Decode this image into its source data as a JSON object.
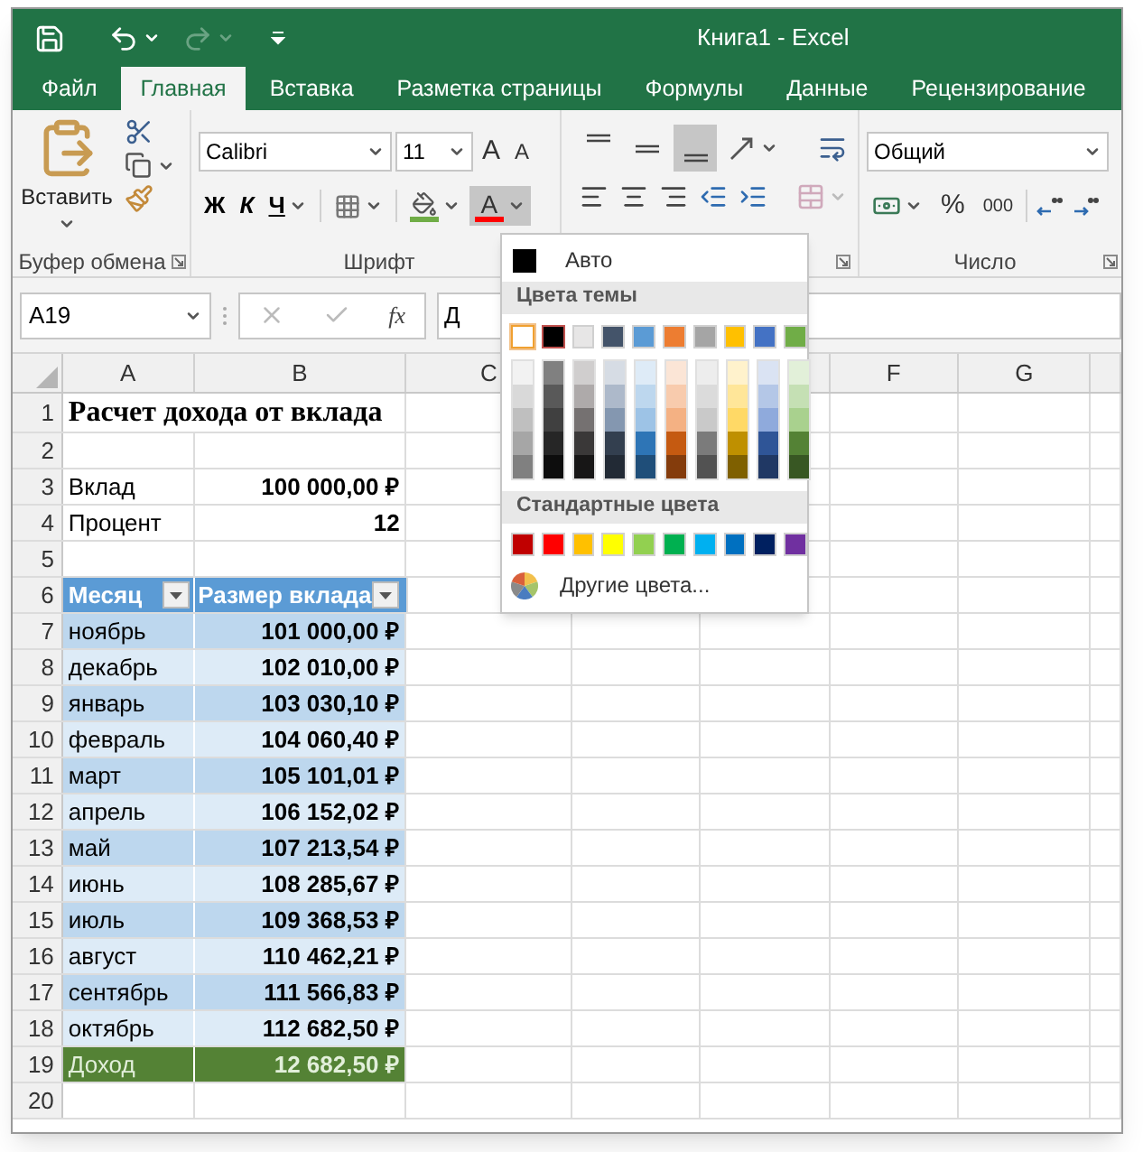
{
  "title_bar": {
    "title": "Книга1 - Excel",
    "redo_disabled": true
  },
  "tabs": [
    {
      "label": "Файл",
      "selected": false
    },
    {
      "label": "Главная",
      "selected": true
    },
    {
      "label": "Вставка",
      "selected": false
    },
    {
      "label": "Разметка страницы",
      "selected": false
    },
    {
      "label": "Формулы",
      "selected": false
    },
    {
      "label": "Данные",
      "selected": false
    },
    {
      "label": "Рецензирование",
      "selected": false
    }
  ],
  "ribbon": {
    "clipboard": {
      "paste_label": "Вставить",
      "group_label": "Буфер обмена"
    },
    "font": {
      "font_name": "Calibri",
      "font_size": "11",
      "grow_label": "A",
      "shrink_label": "A",
      "bold_label": "Ж",
      "italic_label": "К",
      "underline_label": "Ч",
      "font_color_label": "A",
      "font_color_bar": {
        "color": "#ff0000"
      },
      "fill_color_bar": {
        "color": "#70ad47"
      },
      "font_color_open": true,
      "group_label": "Шрифт"
    },
    "alignment": {
      "vertical": [
        {
          "kind": "top",
          "selected": false
        },
        {
          "kind": "middle",
          "selected": false
        },
        {
          "kind": "bottom",
          "selected": true
        }
      ],
      "merge_disabled": true
    },
    "number": {
      "format": "Общий",
      "percent_label": "%",
      "thousands_label": "000",
      "group_label": "Число"
    }
  },
  "formula_bar": {
    "name_box": "A19",
    "fx_label": "fx",
    "value": "Д"
  },
  "sheet": {
    "columns": [
      "A",
      "B",
      "C",
      null,
      null,
      "F",
      "G"
    ],
    "rows": [
      {
        "number": "1",
        "kind": "title",
        "cells": [
          "Расчет дохода от вклада"
        ]
      },
      {
        "number": "2",
        "kind": "empty"
      },
      {
        "number": "3",
        "kind": "plain",
        "cells": [
          "Вклад",
          "100 000,00 ₽"
        ]
      },
      {
        "number": "4",
        "kind": "plain",
        "cells": [
          "Процент",
          "12"
        ]
      },
      {
        "number": "5",
        "kind": "empty"
      },
      {
        "number": "6",
        "kind": "header",
        "cells": [
          "Месяц",
          "Размер вклада"
        ]
      },
      {
        "number": "7",
        "kind": "data",
        "cells": [
          "ноябрь",
          "101 000,00 ₽"
        ]
      },
      {
        "number": "8",
        "kind": "data",
        "cells": [
          "декабрь",
          "102 010,00 ₽"
        ]
      },
      {
        "number": "9",
        "kind": "data",
        "cells": [
          "январь",
          "103 030,10 ₽"
        ]
      },
      {
        "number": "10",
        "kind": "data",
        "cells": [
          "февраль",
          "104 060,40 ₽"
        ]
      },
      {
        "number": "11",
        "kind": "data",
        "cells": [
          "март",
          "105 101,01 ₽"
        ]
      },
      {
        "number": "12",
        "kind": "data",
        "cells": [
          "апрель",
          "106 152,02 ₽"
        ]
      },
      {
        "number": "13",
        "kind": "data",
        "cells": [
          "май",
          "107 213,54 ₽"
        ]
      },
      {
        "number": "14",
        "kind": "data",
        "cells": [
          "июнь",
          "108 285,67 ₽"
        ]
      },
      {
        "number": "15",
        "kind": "data",
        "cells": [
          "июль",
          "109 368,53 ₽"
        ]
      },
      {
        "number": "16",
        "kind": "data",
        "cells": [
          "август",
          "110 462,21 ₽"
        ]
      },
      {
        "number": "17",
        "kind": "data",
        "cells": [
          "сентябрь",
          "111 566,83 ₽"
        ]
      },
      {
        "number": "18",
        "kind": "data",
        "cells": [
          "октябрь",
          "112 682,50 ₽"
        ]
      },
      {
        "number": "19",
        "kind": "total",
        "cells": [
          "Доход",
          "12 682,50 ₽"
        ]
      },
      {
        "number": "20",
        "kind": "empty"
      }
    ]
  },
  "color_menu": {
    "auto_label": "Авто",
    "auto_swatch": {
      "color": "#000000"
    },
    "theme_heading": "Цвета темы",
    "theme_colors": [
      {
        "color": "#ffffff",
        "selected": false,
        "hovered": true,
        "shades": [
          {
            "color": "#f2f2f2"
          },
          {
            "color": "#d9d9d9"
          },
          {
            "color": "#bfbfbf"
          },
          {
            "color": "#a6a6a6"
          },
          {
            "color": "#808080"
          }
        ]
      },
      {
        "color": "#000000",
        "selected": true,
        "hovered": false,
        "shades": [
          {
            "color": "#808080"
          },
          {
            "color": "#595959"
          },
          {
            "color": "#404040"
          },
          {
            "color": "#262626"
          },
          {
            "color": "#0d0d0d"
          }
        ]
      },
      {
        "color": "#e7e6e6",
        "selected": false,
        "hovered": false,
        "shades": [
          {
            "color": "#d0cece"
          },
          {
            "color": "#aeaaaa"
          },
          {
            "color": "#757171"
          },
          {
            "color": "#3a3838"
          },
          {
            "color": "#171616"
          }
        ]
      },
      {
        "color": "#44546a",
        "selected": false,
        "hovered": false,
        "shades": [
          {
            "color": "#d6dce4"
          },
          {
            "color": "#adb9ca"
          },
          {
            "color": "#8497b0"
          },
          {
            "color": "#333f4f"
          },
          {
            "color": "#222a35"
          }
        ]
      },
      {
        "color": "#5b9bd5",
        "selected": false,
        "hovered": false,
        "shades": [
          {
            "color": "#deebf7"
          },
          {
            "color": "#bdd7ee"
          },
          {
            "color": "#9dc3e6"
          },
          {
            "color": "#2e75b6"
          },
          {
            "color": "#1f4e79"
          }
        ]
      },
      {
        "color": "#ed7d31",
        "selected": false,
        "hovered": false,
        "shades": [
          {
            "color": "#fbe5d6"
          },
          {
            "color": "#f8cbad"
          },
          {
            "color": "#f4b183"
          },
          {
            "color": "#c55a11"
          },
          {
            "color": "#843c0c"
          }
        ]
      },
      {
        "color": "#a5a5a5",
        "selected": false,
        "hovered": false,
        "shades": [
          {
            "color": "#ededed"
          },
          {
            "color": "#dbdbdb"
          },
          {
            "color": "#c9c9c9"
          },
          {
            "color": "#7b7b7b"
          },
          {
            "color": "#525252"
          }
        ]
      },
      {
        "color": "#ffc000",
        "selected": false,
        "hovered": false,
        "shades": [
          {
            "color": "#fff2cc"
          },
          {
            "color": "#ffe699"
          },
          {
            "color": "#ffd966"
          },
          {
            "color": "#bf9000"
          },
          {
            "color": "#7f6000"
          }
        ]
      },
      {
        "color": "#4472c4",
        "selected": false,
        "hovered": false,
        "shades": [
          {
            "color": "#dae3f3"
          },
          {
            "color": "#b4c7e7"
          },
          {
            "color": "#8faadc"
          },
          {
            "color": "#2f5597"
          },
          {
            "color": "#203864"
          }
        ]
      },
      {
        "color": "#70ad47",
        "selected": false,
        "hovered": false,
        "shades": [
          {
            "color": "#e2f0d9"
          },
          {
            "color": "#c5e0b4"
          },
          {
            "color": "#a9d18e"
          },
          {
            "color": "#548235"
          },
          {
            "color": "#385723"
          }
        ]
      }
    ],
    "standard_heading": "Стандартные цвета",
    "standard_colors": [
      {
        "color": "#c00000"
      },
      {
        "color": "#ff0000"
      },
      {
        "color": "#ffc000"
      },
      {
        "color": "#ffff00"
      },
      {
        "color": "#92d050"
      },
      {
        "color": "#00b050"
      },
      {
        "color": "#00b0f0"
      },
      {
        "color": "#0070c0"
      },
      {
        "color": "#002060"
      },
      {
        "color": "#7030a0"
      }
    ],
    "more_label": "Другие цвета..."
  }
}
